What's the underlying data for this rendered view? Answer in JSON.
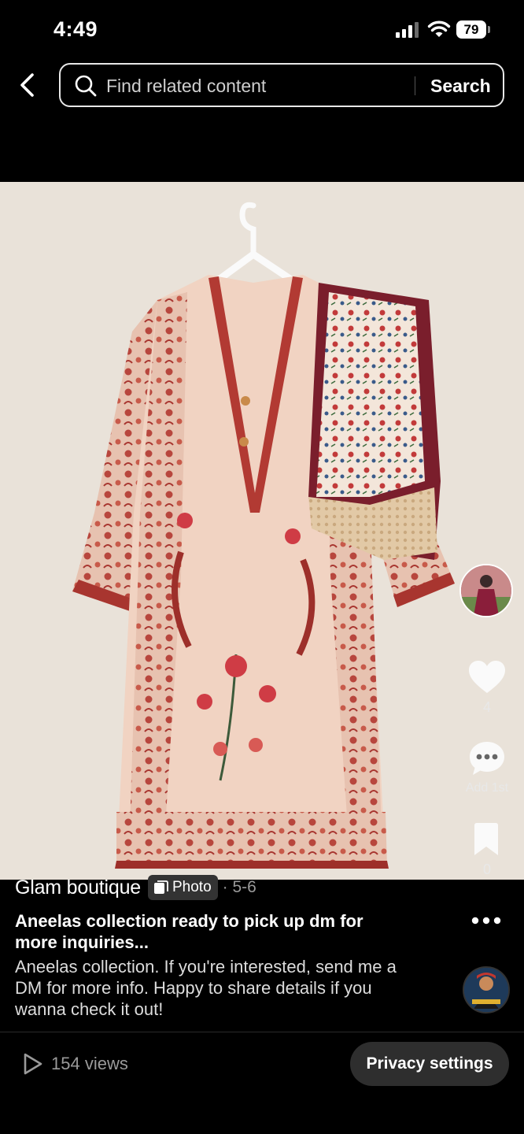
{
  "status_bar": {
    "time": "4:49",
    "battery": "79",
    "icons": [
      "signal-icon",
      "wifi-icon",
      "battery-icon"
    ]
  },
  "header": {
    "back_icon": "chevron-left-icon",
    "search_placeholder": "Find related content",
    "search_button": "Search"
  },
  "photo": {
    "subject": "kurta-with-dupatta-on-hanger",
    "colors": {
      "background": "#e9e2d9",
      "fabric": "#f1d3c2",
      "print": "#b5403b",
      "dupatta": "#7a1e2c"
    }
  },
  "actions": {
    "likes": "4",
    "comment_label": "Add 1st",
    "saves": "0"
  },
  "post": {
    "author": "Glam boutique",
    "type_label": "Photo",
    "date": "· 5-6",
    "title": "Aneelas collection ready to pick up dm for more inquiries...",
    "description": "Aneelas collection. If you're interested, send me a DM for more info. Happy to share details if you wanna check it out!"
  },
  "footer": {
    "views": "154 views",
    "privacy_button": "Privacy settings"
  }
}
